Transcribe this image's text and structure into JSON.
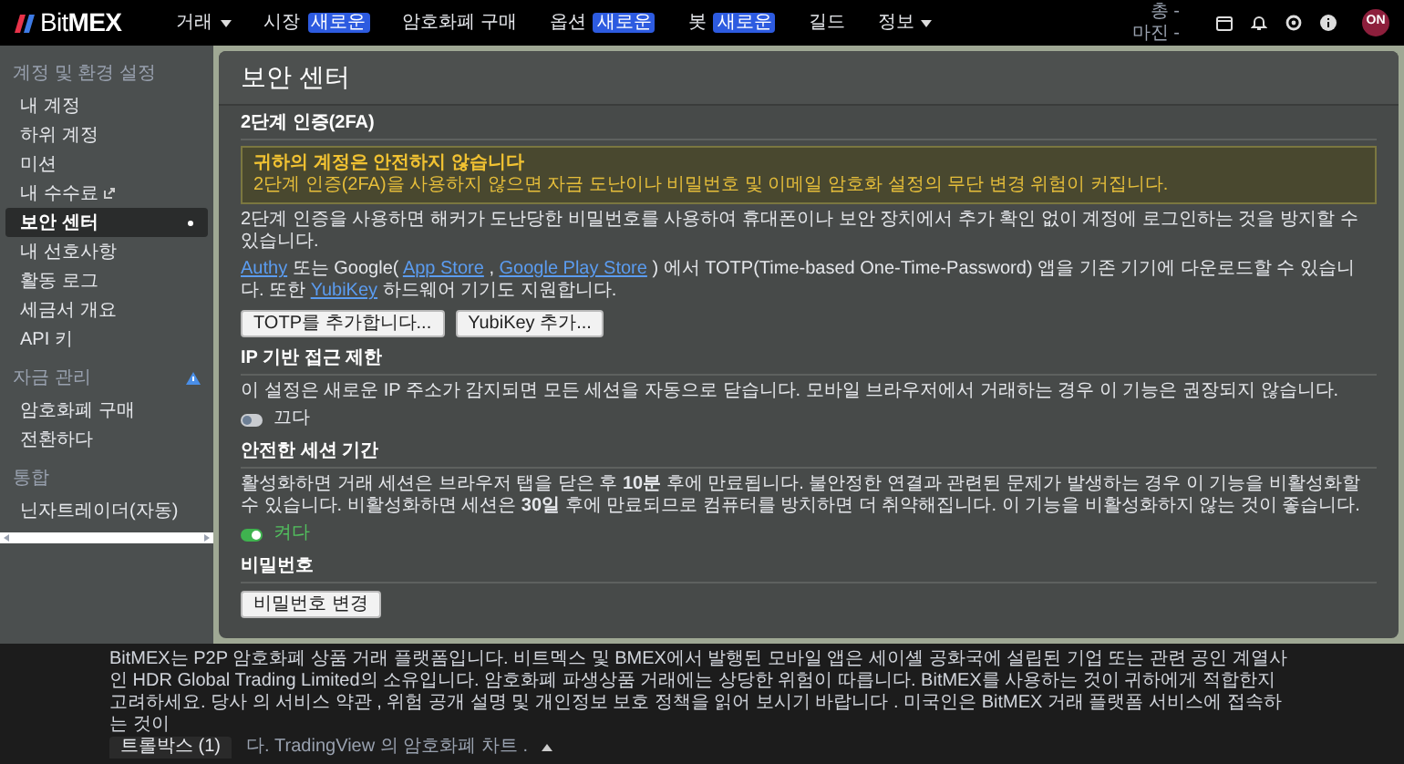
{
  "topbar": {
    "logo": "Bit**MEX**",
    "nav": [
      {
        "label": "거래",
        "kind": "dropdown"
      },
      {
        "label": "시장",
        "kind": "badge",
        "badge": "새로운"
      },
      {
        "label": "암호화폐 구매",
        "kind": "plain"
      },
      {
        "label": "옵션",
        "kind": "badge",
        "badge": "새로운"
      },
      {
        "label": "봇",
        "kind": "badge",
        "badge": "새로운"
      },
      {
        "label": "길드",
        "kind": "plain"
      },
      {
        "label": "정보",
        "kind": "dropdown"
      }
    ],
    "balance_lines": [
      "총 -",
      "마진 -"
    ],
    "avatar": "ON"
  },
  "sidebar": {
    "groups": [
      {
        "title": "계정 및 환경 설정",
        "warning": false,
        "items": [
          {
            "label": "내 계정",
            "selected": false,
            "external": false
          },
          {
            "label": "하위 계정",
            "selected": false,
            "external": false
          },
          {
            "label": "미션",
            "selected": false,
            "external": false
          },
          {
            "label": "내 수수료",
            "selected": false,
            "external": true
          },
          {
            "label": "보안 센터",
            "selected": true,
            "external": false
          },
          {
            "label": "내 선호사항",
            "selected": false,
            "external": false
          },
          {
            "label": "활동 로그",
            "selected": false,
            "external": false
          },
          {
            "label": "세금서 개요",
            "selected": false,
            "external": false
          },
          {
            "label": "API 키",
            "selected": false,
            "external": false
          }
        ]
      },
      {
        "title": "자금 관리",
        "warning": true,
        "items": [
          {
            "label": "암호화폐 구매",
            "selected": false,
            "external": false
          },
          {
            "label": "전환하다",
            "selected": false,
            "external": false
          }
        ]
      },
      {
        "title": "통합",
        "warning": false,
        "items": [
          {
            "label": "닌자트레이더(자동)",
            "selected": false,
            "external": false
          }
        ]
      }
    ]
  },
  "page": {
    "title": "보안 센터",
    "sections": [
      {
        "kind": "twofa",
        "heading": "2단계 인증(2FA)",
        "alert": {
          "title": "귀하의 계정은 안전하지 않습니다",
          "text": "2단계 인증(2FA)을 사용하지 않으면 자금 도난이나 비밀번호 및 이메일 암호화 설정의 무단 변경 위험이 커집니다."
        },
        "description": "2단계 인증을 사용하면 해커가 도난당한 비밀번호를 사용하여 휴대폰이나 보안 장치에서 추가 확인 없이 계정에 로그인하는 것을 방지할 수 있습니다.",
        "apps_text": [
          {
            "text": "Authy",
            "link": true
          },
          {
            "text": " 또는 Google( ",
            "link": false
          },
          {
            "text": "App Store",
            "link": true
          },
          {
            "text": " , ",
            "link": false
          },
          {
            "text": "Google Play Store",
            "link": true
          },
          {
            "text": " ) 에서 TOTP(Time-based One-Time-Password) 앱을 기존 기기에 다운로드할 수 있습니다. 또한 ",
            "link": false
          },
          {
            "text": "YubiKey",
            "link": true
          },
          {
            "text": " 하드웨어 기기도 지원합니다.",
            "link": false
          }
        ],
        "buttons": [
          "TOTP를 추가합니다...",
          "YubiKey 추가..."
        ]
      },
      {
        "kind": "toggle",
        "heading": "IP 기반 접근 제한",
        "description": "이 설정은 새로운 IP 주소가 감지되면 모든 세션을 자동으로 닫습니다. 모바일 브라우저에서 거래하는 경우 이 기능은 권장되지 않습니다.",
        "toggle": {
          "on": false,
          "label": "끄다"
        }
      },
      {
        "kind": "toggle",
        "heading": "안전한 세션 기간",
        "description": "활성화하면 거래 세션은 브라우저 탭을 닫은 후 **10분** 후에 만료됩니다. 불안정한 연결과 관련된 문제가 발생하는 경우 이 기능을 비활성화할 수 있습니다. 비활성화하면 세션은 **30일** 후에 만료되므로 컴퓨터를 방치하면 더 취약해집니다. 이 기능을 비활성화하지 않는 것이 좋습니다.",
        "toggle": {
          "on": true,
          "label": "켜다"
        }
      },
      {
        "kind": "password",
        "heading": "비밀번호",
        "buttons": [
          "비밀번호 변경"
        ]
      }
    ]
  },
  "footer": {
    "text": "BitMEX는 P2P 암호화폐 상품 거래 플랫폼입니다. 비트멕스 및 BMEX에서 발행된 모바일 앱은 세이셸 공화국에 설립된 기업 또는 관련 공인 계열사인 HDR Global Trading Limited의 소유입니다. 암호화폐 파생상품 거래에는 상당한 위험이 따릅니다. BitMEX를 사용하는 것이 귀하에게 적합한지 고려하세요. 당사 의 서비스 약관 , 위험 공개 설명 및 개인정보 보호 정책을 읽어 보시기 바랍니다 . 미국인은 BitMEX 거래 플랫폼 서비스에 접속하는 것이",
    "trollbox": "트롤박스 (1)",
    "tail": "다. TradingView 의 암호화폐 차트 ."
  }
}
